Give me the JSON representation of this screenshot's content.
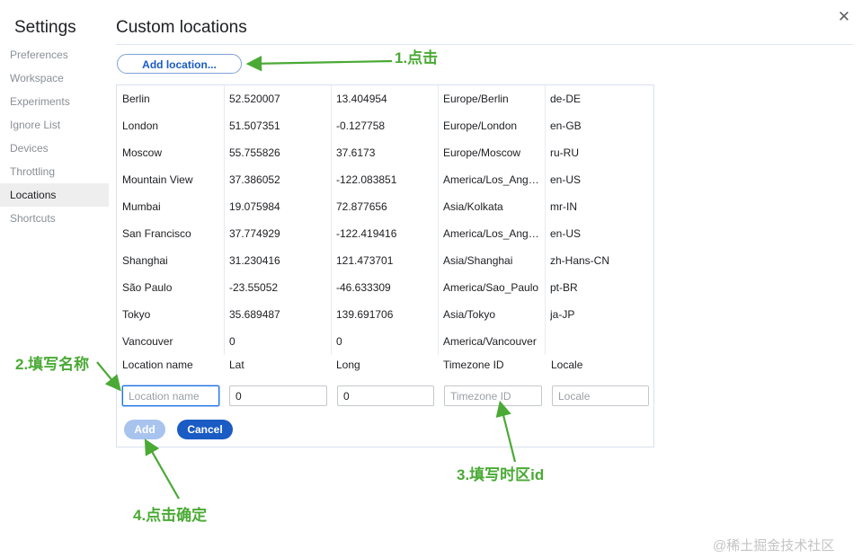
{
  "sidebar": {
    "title": "Settings",
    "items": [
      {
        "label": "Preferences"
      },
      {
        "label": "Workspace"
      },
      {
        "label": "Experiments"
      },
      {
        "label": "Ignore List"
      },
      {
        "label": "Devices"
      },
      {
        "label": "Throttling"
      },
      {
        "label": "Locations",
        "active": true
      },
      {
        "label": "Shortcuts"
      }
    ]
  },
  "main": {
    "title": "Custom locations",
    "add_location_label": "Add location...",
    "rows": [
      {
        "name": "Berlin",
        "lat": "52.520007",
        "long": "13.404954",
        "tz": "Europe/Berlin",
        "locale": "de-DE"
      },
      {
        "name": "London",
        "lat": "51.507351",
        "long": "-0.127758",
        "tz": "Europe/London",
        "locale": "en-GB"
      },
      {
        "name": "Moscow",
        "lat": "55.755826",
        "long": "37.6173",
        "tz": "Europe/Moscow",
        "locale": "ru-RU"
      },
      {
        "name": "Mountain View",
        "lat": "37.386052",
        "long": "-122.083851",
        "tz": "America/Los_Angeles",
        "locale": "en-US"
      },
      {
        "name": "Mumbai",
        "lat": "19.075984",
        "long": "72.877656",
        "tz": "Asia/Kolkata",
        "locale": "mr-IN"
      },
      {
        "name": "San Francisco",
        "lat": "37.774929",
        "long": "-122.419416",
        "tz": "America/Los_Angeles",
        "locale": "en-US"
      },
      {
        "name": "Shanghai",
        "lat": "31.230416",
        "long": "121.473701",
        "tz": "Asia/Shanghai",
        "locale": "zh-Hans-CN"
      },
      {
        "name": "São Paulo",
        "lat": "-23.55052",
        "long": "-46.633309",
        "tz": "America/Sao_Paulo",
        "locale": "pt-BR"
      },
      {
        "name": "Tokyo",
        "lat": "35.689487",
        "long": "139.691706",
        "tz": "Asia/Tokyo",
        "locale": "ja-JP"
      },
      {
        "name": "Vancouver",
        "lat": "0",
        "long": "0",
        "tz": "America/Vancouver",
        "locale": ""
      }
    ],
    "form": {
      "headers": {
        "name": "Location name",
        "lat": "Lat",
        "long": "Long",
        "tz": "Timezone ID",
        "locale": "Locale"
      },
      "placeholders": {
        "name": "Location name",
        "tz": "Timezone ID",
        "locale": "Locale"
      },
      "values": {
        "lat": "0",
        "long": "0"
      },
      "add_label": "Add",
      "cancel_label": "Cancel"
    }
  },
  "annotations": {
    "step1": "1.点击",
    "step2": "2.填写名称",
    "step3": "3.填写时区id",
    "step4": "4.点击确定",
    "color": "#4aaa35"
  },
  "watermark": "@稀土掘金技术社区",
  "colors": {
    "accent": "#1a5bc4",
    "add_disabled": "#a8c4ee",
    "annotation": "#4aaa35"
  },
  "icons": {
    "close": "close-icon"
  }
}
